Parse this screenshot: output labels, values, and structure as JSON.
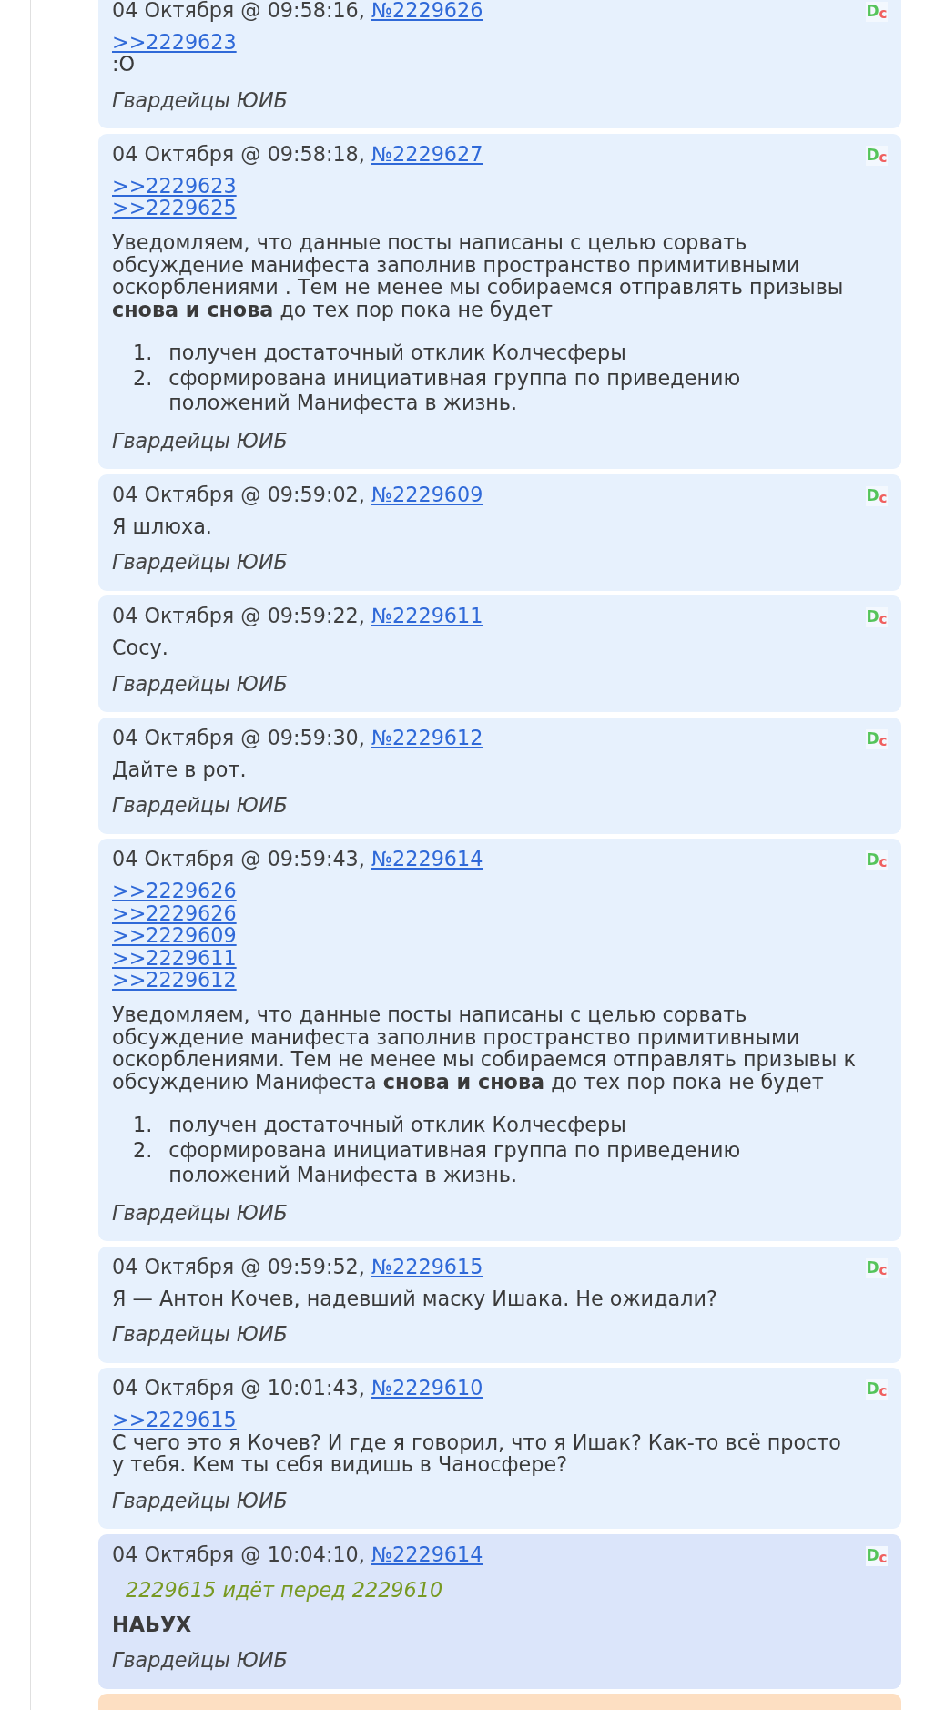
{
  "posts": [
    {
      "date": "04 Октября @ 09:58:16,",
      "number": "№2229626",
      "logo": "D$_{c}$",
      "highlighted": false,
      "body": [
        {
          "kind": "paragraph",
          "lines": [
            {
              "kind": "link",
              "text": ">>2229623"
            },
            {
              "kind": "text",
              "text": ":O"
            }
          ]
        }
      ],
      "signature": "Гвардейцы ЮИБ"
    },
    {
      "date": "04 Октября @ 09:58:18,",
      "number": "№2229627",
      "logo": "D$_{c}$",
      "highlighted": false,
      "body": [
        {
          "kind": "paragraph",
          "lines": [
            {
              "kind": "link",
              "text": ">>2229623"
            },
            {
              "kind": "link",
              "text": ">>2229625"
            }
          ]
        },
        {
          "kind": "paragraph",
          "lines": [
            {
              "kind": "text",
              "text": "Уведомляем, что данные посты написаны с целью сорвать обсуждение манифеста заполнив пространство примитивными оскорблениями . Тем не менее мы собираемся отправлять призывы **снова и снова** до тех пор пока не будет"
            }
          ]
        },
        {
          "kind": "list",
          "items": [
            {
              "number": "1.",
              "text": "получен достаточный отклик Колчесферы"
            },
            {
              "number": "2.",
              "text": "сформирована инициативная группа по приведению положений Манифеста в жизнь."
            }
          ]
        }
      ],
      "signature": "Гвардейцы ЮИБ"
    },
    {
      "date": "04 Октября @ 09:59:02,",
      "number": "№2229609",
      "logo": "D$_{c}$",
      "highlighted": false,
      "body": [
        {
          "kind": "paragraph",
          "lines": [
            {
              "kind": "text",
              "text": "Я шлюха."
            }
          ]
        }
      ],
      "signature": "Гвардейцы ЮИБ"
    },
    {
      "date": "04 Октября @ 09:59:22,",
      "number": "№2229611",
      "logo": "D$_{c}$",
      "highlighted": false,
      "body": [
        {
          "kind": "paragraph",
          "lines": [
            {
              "kind": "text",
              "text": "Сосу."
            }
          ]
        }
      ],
      "signature": "Гвардейцы ЮИБ"
    },
    {
      "date": "04 Октября @ 09:59:30,",
      "number": "№2229612",
      "logo": "D$_{c}$",
      "highlighted": false,
      "body": [
        {
          "kind": "paragraph",
          "lines": [
            {
              "kind": "text",
              "text": "Дайте в рот."
            }
          ]
        }
      ],
      "signature": "Гвардейцы ЮИБ"
    },
    {
      "date": "04 Октября @ 09:59:43,",
      "number": "№2229614",
      "logo": "D$_{c}$",
      "highlighted": false,
      "body": [
        {
          "kind": "paragraph",
          "lines": [
            {
              "kind": "link",
              "text": ">>2229626"
            },
            {
              "kind": "link",
              "text": ">>2229626"
            },
            {
              "kind": "link",
              "text": ">>2229609"
            },
            {
              "kind": "link",
              "text": ">>2229611"
            },
            {
              "kind": "link",
              "text": ">>2229612"
            }
          ]
        },
        {
          "kind": "paragraph",
          "lines": [
            {
              "kind": "text",
              "text": "Уведомляем, что данные посты написаны с целью сорвать обсуждение манифеста заполнив пространство примитивными оскорблениями. Тем не менее мы собираемся отправлять призывы к обсуждению Манифеста **снова и снова** до тех пор пока не будет"
            }
          ]
        },
        {
          "kind": "list",
          "items": [
            {
              "number": "1.",
              "text": "получен достаточный отклик Колчесферы"
            },
            {
              "number": "2.",
              "text": "сформирована инициативная группа по приведению положений Манифеста в жизнь."
            }
          ]
        }
      ],
      "signature": "Гвардейцы ЮИБ"
    },
    {
      "date": "04 Октября @ 09:59:52,",
      "number": "№2229615",
      "logo": "D$_{c}$",
      "highlighted": false,
      "body": [
        {
          "kind": "paragraph",
          "lines": [
            {
              "kind": "text",
              "text": "Я — Антон Кочев, надевший маску Ишака. Не ожидали?"
            }
          ]
        }
      ],
      "signature": "Гвардейцы ЮИБ"
    },
    {
      "date": "04 Октября @ 10:01:43,",
      "number": "№2229610",
      "logo": "D$_{c}$",
      "highlighted": false,
      "body": [
        {
          "kind": "paragraph",
          "lines": [
            {
              "kind": "link",
              "text": ">>2229615"
            },
            {
              "kind": "text",
              "text": "С чего это я Кочев? И где я говорил, что я Ишак? Как-то всё просто у тебя. Кем ты себя видишь в Чаносфере?"
            }
          ]
        }
      ],
      "signature": "Гвардейцы ЮИБ"
    },
    {
      "date": "04 Октября @ 10:04:10,",
      "number": "№2229614",
      "logo": "D$_{c}$",
      "highlighted": true,
      "body": [
        {
          "kind": "paragraph",
          "lines": [
            {
              "kind": "quote",
              "text": "2229615 идёт перед 2229610"
            }
          ]
        },
        {
          "kind": "paragraph",
          "lines": [
            {
              "kind": "strong",
              "text": "НАЬУХ"
            }
          ]
        }
      ],
      "signature": "Гвардейцы ЮИБ"
    }
  ]
}
